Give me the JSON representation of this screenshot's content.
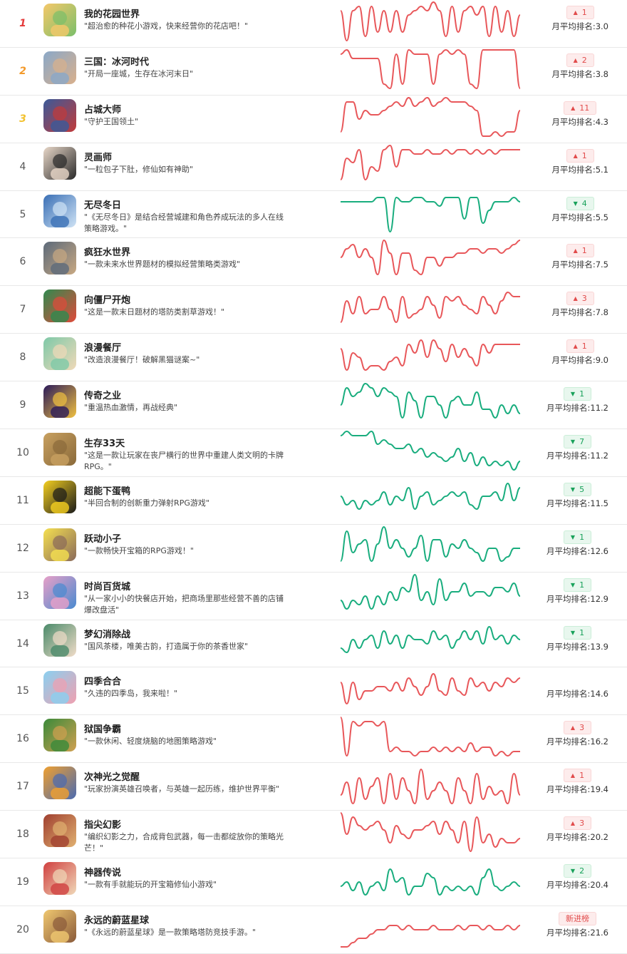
{
  "colors": {
    "up": "#e8575a",
    "down": "#19ad7e"
  },
  "avg_prefix": "月平均排名:",
  "games": [
    {
      "rank": "1",
      "name": "我的花园世界",
      "desc": "\"超治愈的种花小游戏，快来经营你的花店吧！\"",
      "change": "1",
      "direction": "up",
      "avg": "3.0",
      "trend": [
        3,
        10,
        3,
        2,
        9,
        2,
        8,
        3,
        8,
        3,
        8,
        4,
        3,
        2,
        3,
        1,
        3,
        9,
        2,
        8,
        3,
        2,
        4,
        2,
        9,
        2,
        8,
        3,
        9,
        4
      ]
    },
    {
      "rank": "2",
      "name": "三国：冰河时代",
      "desc": "\"开局一座城，生存在冰河末日\"",
      "change": "2",
      "direction": "up",
      "avg": "3.8",
      "trend": [
        2,
        1,
        3,
        3,
        3,
        3,
        3,
        9,
        10,
        2,
        9,
        1,
        2,
        2,
        2,
        9,
        2,
        1,
        2,
        1,
        2,
        9,
        10,
        1,
        1,
        1,
        1,
        1,
        1,
        10
      ]
    },
    {
      "rank": "3",
      "name": "占城大师",
      "desc": "\"守护王国领土\"",
      "change": "11",
      "direction": "up",
      "avg": "4.3",
      "trend": [
        9,
        2,
        2,
        6,
        4,
        5,
        5,
        4,
        3,
        2,
        3,
        1,
        3,
        2,
        1,
        3,
        2,
        1,
        2,
        2,
        2,
        3,
        4,
        10,
        10,
        9,
        10,
        9,
        9,
        4
      ]
    },
    {
      "rank": "4",
      "name": "灵画师",
      "desc": "\"一粒包子下肚，修仙如有神助\"",
      "change": "1",
      "direction": "up",
      "avg": "5.1",
      "trend": [
        9,
        4,
        5,
        2,
        9,
        6,
        7,
        2,
        1,
        6,
        2,
        2,
        3,
        3,
        2,
        3,
        3,
        2,
        3,
        2,
        2,
        3,
        2,
        3,
        2,
        3,
        2,
        2,
        2,
        2
      ]
    },
    {
      "rank": "5",
      "name": "无尽冬日",
      "desc": "\"《无尽冬日》是结合经营城建和角色养成玩法的多人在线策略游戏。\"",
      "change": "4",
      "direction": "down",
      "avg": "5.5",
      "trend": [
        3,
        3,
        3,
        3,
        3,
        3,
        2,
        2,
        10,
        2,
        3,
        3,
        2,
        2,
        3,
        3,
        4,
        2,
        2,
        2,
        7,
        2,
        2,
        8,
        5,
        3,
        3,
        3,
        2,
        3
      ]
    },
    {
      "rank": "6",
      "name": "疯狂水世界",
      "desc": "\"一款未来水世界题材的模拟经营策略类游戏\"",
      "change": "1",
      "direction": "up",
      "avg": "7.5",
      "trend": [
        5,
        3,
        2,
        5,
        3,
        5,
        9,
        1,
        4,
        9,
        4,
        4,
        8,
        9,
        5,
        5,
        7,
        5,
        5,
        4,
        4,
        3,
        3,
        4,
        3,
        3,
        4,
        3,
        2,
        1
      ]
    },
    {
      "rank": "7",
      "name": "向僵尸开炮",
      "desc": "\"这是一款末日题材的塔防类割草游戏！\"",
      "change": "3",
      "direction": "up",
      "avg": "7.8",
      "trend": [
        9,
        4,
        7,
        3,
        7,
        6,
        6,
        3,
        6,
        9,
        3,
        8,
        7,
        6,
        3,
        5,
        8,
        3,
        4,
        3,
        5,
        6,
        7,
        3,
        5,
        7,
        4,
        2,
        3,
        3
      ]
    },
    {
      "rank": "8",
      "name": "浪漫餐厅",
      "desc": "\"改造浪漫餐厅！破解黑猫谜案~\"",
      "change": "1",
      "direction": "up",
      "avg": "9.0",
      "trend": [
        4,
        9,
        5,
        6,
        9,
        8,
        8,
        9,
        7,
        6,
        8,
        3,
        5,
        2,
        6,
        2,
        4,
        7,
        3,
        6,
        4,
        6,
        8,
        3,
        5,
        3,
        3,
        3,
        3,
        3
      ]
    },
    {
      "rank": "9",
      "name": "传奇之业",
      "desc": "\"重温热血激情，再战经典\"",
      "change": "1",
      "direction": "down",
      "avg": "11.2",
      "trend": [
        6,
        2,
        4,
        3,
        1,
        2,
        4,
        2,
        3,
        4,
        9,
        3,
        5,
        9,
        4,
        4,
        6,
        9,
        5,
        4,
        6,
        6,
        3,
        7,
        7,
        9,
        6,
        8,
        6,
        8
      ]
    },
    {
      "rank": "10",
      "name": "生存33天",
      "desc": "\"这是一款让玩家在丧尸横行的世界中重建人类文明的卡牌RPG。\"",
      "change": "7",
      "direction": "down",
      "avg": "11.2",
      "trend": [
        2,
        1,
        2,
        2,
        2,
        1,
        4,
        3,
        4,
        5,
        5,
        4,
        6,
        5,
        7,
        6,
        7,
        8,
        7,
        5,
        8,
        6,
        9,
        7,
        9,
        8,
        9,
        8,
        10,
        8
      ]
    },
    {
      "rank": "11",
      "name": "超能下蛋鸭",
      "desc": "\"半回合制的创新重力弹射RPG游戏\"",
      "change": "5",
      "direction": "down",
      "avg": "11.5",
      "trend": [
        5,
        7,
        6,
        8,
        6,
        7,
        6,
        4,
        7,
        5,
        6,
        3,
        8,
        5,
        4,
        7,
        6,
        5,
        4,
        5,
        4,
        7,
        8,
        5,
        5,
        4,
        6,
        2,
        6,
        3
      ]
    },
    {
      "rank": "12",
      "name": "跃动小子",
      "desc": "\"一款畅快开宝箱的RPG游戏！\"",
      "change": "1",
      "direction": "down",
      "avg": "12.6",
      "trend": [
        9,
        2,
        7,
        5,
        4,
        9,
        5,
        1,
        6,
        4,
        6,
        8,
        6,
        3,
        9,
        4,
        4,
        8,
        5,
        6,
        4,
        6,
        7,
        9,
        6,
        6,
        9,
        8,
        6,
        6
      ]
    },
    {
      "rank": "13",
      "name": "时尚百货城",
      "desc": "\"从一家小小的快餐店开始，把商场里那些经营不善的店铺爆改盘活\"",
      "change": "1",
      "direction": "down",
      "avg": "12.9",
      "trend": [
        7,
        9,
        7,
        8,
        6,
        9,
        6,
        8,
        5,
        7,
        4,
        5,
        1,
        7,
        5,
        8,
        2,
        7,
        5,
        5,
        3,
        6,
        5,
        5,
        6,
        4,
        4,
        5,
        3,
        6
      ]
    },
    {
      "rank": "14",
      "name": "梦幻消除战",
      "desc": "\"国风茶楼，唯美古韵，打造属于你的茶香世家\"",
      "change": "1",
      "direction": "down",
      "avg": "13.9",
      "trend": [
        7,
        8,
        5,
        7,
        5,
        4,
        7,
        3,
        6,
        4,
        7,
        4,
        5,
        5,
        6,
        3,
        5,
        4,
        7,
        5,
        3,
        5,
        3,
        6,
        2,
        5,
        4,
        6,
        4,
        5
      ]
    },
    {
      "rank": "15",
      "name": "四季合合",
      "desc": "\"久违的四季岛，我来啦！\"",
      "change": "",
      "direction": "none",
      "avg": "14.6",
      "trend": [
        4,
        9,
        4,
        8,
        6,
        6,
        5,
        5,
        6,
        4,
        6,
        3,
        5,
        7,
        5,
        2,
        6,
        7,
        3,
        6,
        7,
        3,
        5,
        4,
        6,
        4,
        5,
        3,
        4,
        3
      ]
    },
    {
      "rank": "16",
      "name": "狱国争霸",
      "desc": "\"一款休闲、轻度烧脑的地图策略游戏\"",
      "change": "3",
      "direction": "up",
      "avg": "16.2",
      "trend": [
        1,
        10,
        2,
        3,
        2,
        2,
        3,
        2,
        9,
        8,
        9,
        9,
        10,
        9,
        9,
        8,
        9,
        8,
        9,
        8,
        9,
        7,
        9,
        8,
        8,
        10,
        9,
        10,
        9,
        9
      ]
    },
    {
      "rank": "17",
      "name": "次神光之觉醒",
      "desc": "\"玩家扮演英雄召唤者，与英雄一起历练，维护世界平衡\"",
      "change": "1",
      "direction": "up",
      "avg": "19.4",
      "trend": [
        8,
        5,
        10,
        4,
        9,
        6,
        4,
        10,
        3,
        9,
        4,
        7,
        10,
        2,
        9,
        7,
        5,
        7,
        10,
        4,
        7,
        10,
        3,
        9,
        6,
        8,
        7,
        10,
        3,
        8
      ]
    },
    {
      "rank": "18",
      "name": "指尖幻影",
      "desc": "\"编织幻影之力，合成背包武器，每一击都绽放你的策略光芒！\"",
      "change": "3",
      "direction": "up",
      "avg": "20.2",
      "trend": [
        1,
        6,
        2,
        4,
        5,
        4,
        3,
        5,
        8,
        4,
        6,
        7,
        5,
        5,
        4,
        3,
        6,
        3,
        5,
        8,
        3,
        10,
        2,
        8,
        6,
        9,
        7,
        8,
        8,
        7
      ]
    },
    {
      "rank": "19",
      "name": "神器传说",
      "desc": "\"一款有手就能玩的开宝箱修仙小游戏\"",
      "change": "2",
      "direction": "down",
      "avg": "20.4",
      "trend": [
        7,
        6,
        8,
        6,
        9,
        7,
        6,
        8,
        3,
        6,
        5,
        9,
        7,
        7,
        4,
        5,
        9,
        7,
        8,
        7,
        8,
        7,
        9,
        5,
        3,
        7,
        8,
        7,
        6,
        7
      ]
    },
    {
      "rank": "20",
      "name": "永远的蔚蓝星球",
      "desc": "\"《永远的蔚蓝星球》是一款策略塔防竞技手游。\"",
      "change": "新进榜",
      "direction": "new",
      "avg": "21.6",
      "trend": [
        10,
        10,
        9,
        8,
        8,
        7,
        6,
        6,
        5,
        5,
        6,
        5,
        6,
        6,
        6,
        5,
        6,
        6,
        6,
        5,
        6,
        5,
        5,
        6,
        5,
        6,
        6,
        5,
        6,
        5
      ]
    }
  ]
}
